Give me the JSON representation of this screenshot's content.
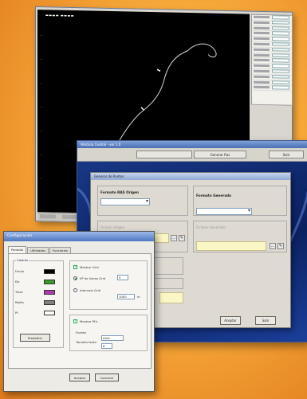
{
  "plot_window": {
    "title": "▬▬▬▬ ▬▬▬▬",
    "status_segments": [
      "",
      "",
      "",
      "",
      ""
    ]
  },
  "points_window": {
    "title": "Ventana Control - ver 1.0",
    "menu_buttons": [
      "Generar Ras",
      "Salir"
    ],
    "dialog": {
      "title": "Generar de Puntos",
      "input_format_label": "Formato RAS Origen",
      "output_format_label": "Formato Generado",
      "source_label": "Fichero Origen",
      "generated_label": "Fichero Generado",
      "ok_label": "Aceptar",
      "cancel_label": "Salir"
    }
  },
  "config_window": {
    "title": "Configuración",
    "tabs": [
      "Pantalla",
      "Utilidades",
      "Funciones"
    ],
    "colors_group_title": "Colores",
    "color_rows": [
      {
        "label": "Fondo",
        "color": "#000000"
      },
      {
        "label": "Eje",
        "color": "#3a9a2a"
      },
      {
        "label": "Traza",
        "color": "#b03ab0"
      },
      {
        "label": "Rejilla",
        "color": "#808080"
      },
      {
        "label": "Pt",
        "color": "#ffffff"
      }
    ],
    "defaults_button": "Predefinir",
    "grid_checkbox": "Mostrar Grid",
    "grid_step_label": "Nº de líneas Grid",
    "grid_step_value": "5",
    "grid_interval_label": "Intervalo Grid",
    "grid_interval_value": "1000",
    "grid_interval_unit": "m",
    "points_checkbox": "Mostrar Pt's",
    "font_label": "Fuente",
    "font_value": "Arial",
    "size_label": "Tamaño texto",
    "size_value": "8",
    "ok_label": "Aceptar",
    "cancel_label": "Cancelar"
  },
  "colors": {
    "background_start": "#ffd98a",
    "background_end": "#e07b1c",
    "plot_bg": "#000000",
    "dialog_bg": "#dedad2",
    "titlebar_blue": "#4f77c3"
  }
}
